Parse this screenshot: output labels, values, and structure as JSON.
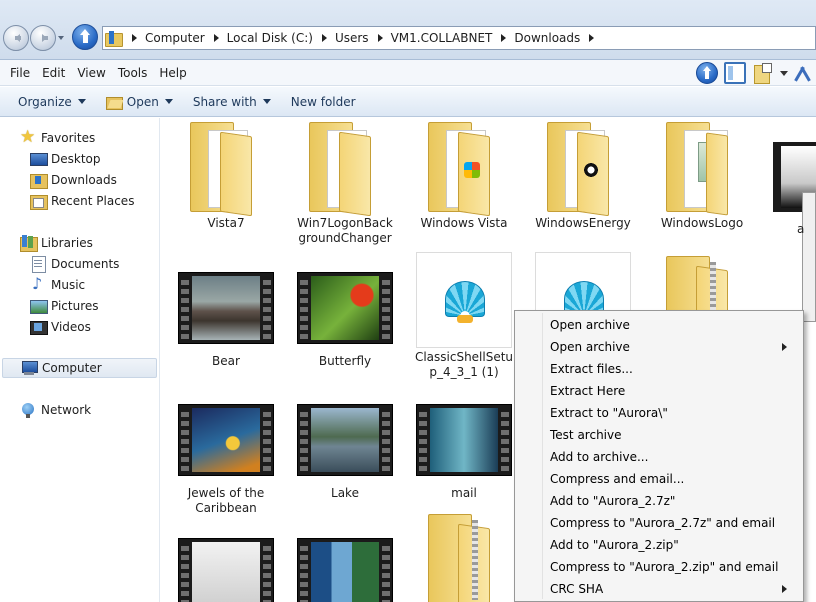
{
  "breadcrumb": [
    "Computer",
    "Local Disk (C:)",
    "Users",
    "VM1.COLLABNET",
    "Downloads"
  ],
  "menubar": [
    "File",
    "Edit",
    "View",
    "Tools",
    "Help"
  ],
  "commands": {
    "organize": "Organize",
    "open": "Open",
    "share": "Share with",
    "new_folder": "New folder"
  },
  "sidebar": {
    "favorites": "Favorites",
    "desktop": "Desktop",
    "downloads": "Downloads",
    "recent": "Recent Places",
    "libraries": "Libraries",
    "documents": "Documents",
    "music": "Music",
    "pictures": "Pictures",
    "videos": "Videos",
    "computer": "Computer",
    "network": "Network"
  },
  "files": [
    {
      "label": "Vista7",
      "kind": "folder"
    },
    {
      "label": "Win7LogonBackgroundChanger",
      "kind": "folder"
    },
    {
      "label": "Windows Vista",
      "kind": "folder"
    },
    {
      "label": "WindowsEnergy",
      "kind": "folder"
    },
    {
      "label": "WindowsLogo",
      "kind": "folder"
    },
    {
      "label": "Bear",
      "kind": "video"
    },
    {
      "label": "Butterfly",
      "kind": "video"
    },
    {
      "label": "ClassicShellSetup_4_3_1 (1)",
      "kind": "app"
    },
    {
      "label": "Jewels of the Caribbean",
      "kind": "video"
    },
    {
      "label": "Lake",
      "kind": "video"
    },
    {
      "label": "mail",
      "kind": "video"
    }
  ],
  "edge_label": "a",
  "context_menu": [
    {
      "label": "Open archive",
      "submenu": false
    },
    {
      "label": "Open archive",
      "submenu": true
    },
    {
      "label": "Extract files...",
      "submenu": false
    },
    {
      "label": "Extract Here",
      "submenu": false
    },
    {
      "label": "Extract to \"Aurora\\\"",
      "submenu": false
    },
    {
      "label": "Test archive",
      "submenu": false
    },
    {
      "label": "Add to archive...",
      "submenu": false
    },
    {
      "label": "Compress and email...",
      "submenu": false
    },
    {
      "label": "Add to \"Aurora_2.7z\"",
      "submenu": false
    },
    {
      "label": "Compress to \"Aurora_2.7z\" and email",
      "submenu": false
    },
    {
      "label": "Add to \"Aurora_2.zip\"",
      "submenu": false
    },
    {
      "label": "Compress to \"Aurora_2.zip\" and email",
      "submenu": false
    },
    {
      "label": "CRC SHA",
      "submenu": true
    }
  ]
}
